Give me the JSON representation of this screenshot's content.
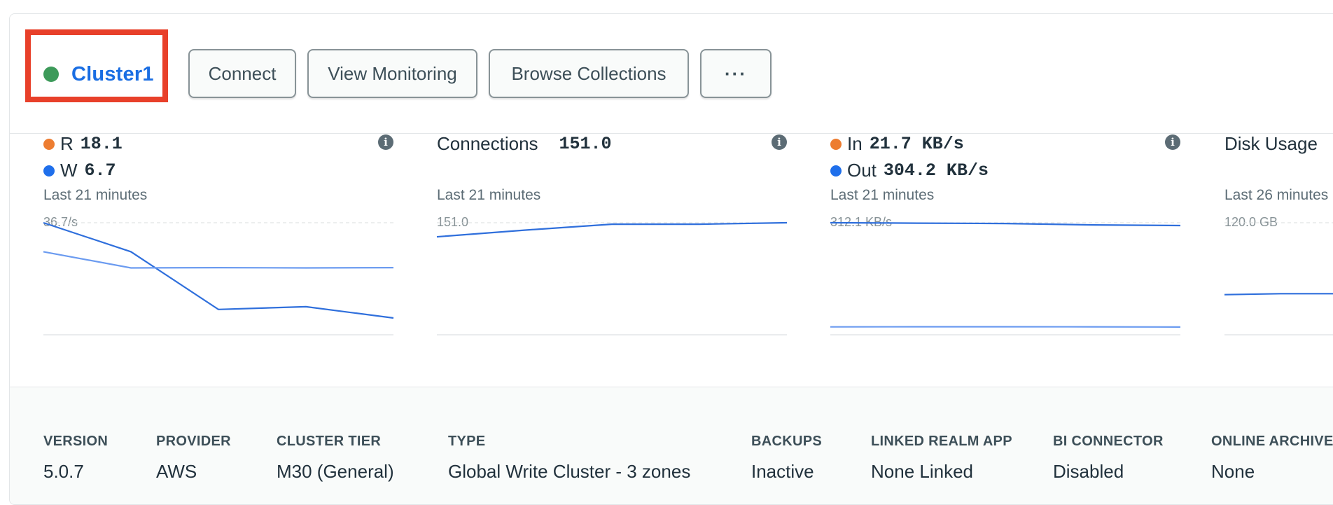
{
  "cluster": {
    "name": "Cluster1",
    "status_color": "#3d9a5a"
  },
  "toolbar": {
    "connect": "Connect",
    "view_monitoring": "View Monitoring",
    "browse_collections": "Browse Collections",
    "more": "···"
  },
  "colors": {
    "orange": "#ed7d31",
    "blue": "#1f6feb",
    "line": "#2f6fdc",
    "line_light": "#6b9bf0"
  },
  "metrics": {
    "opcounters": {
      "r_label": "R",
      "r_value": "18.1",
      "w_label": "W",
      "w_value": "6.7",
      "period": "Last 21 minutes",
      "max": "36.7/s",
      "info_icon": "i"
    },
    "connections": {
      "title": "Connections",
      "value": "151.0",
      "period": "Last 21 minutes",
      "max": "151.0",
      "info_icon": "i"
    },
    "network": {
      "in_label": "In",
      "in_value": "21.7 KB/s",
      "out_label": "Out",
      "out_value": "304.2 KB/s",
      "period": "Last 21 minutes",
      "max": "312.1 KB/s",
      "info_icon": "i"
    },
    "disk": {
      "title": "Disk Usage",
      "period": "Last 26 minutes",
      "max": "120.0 GB"
    }
  },
  "chart_data": [
    {
      "type": "line",
      "series": [
        {
          "values": [
            36.7,
            27.2,
            8.3,
            9.2,
            5.5
          ]
        },
        {
          "values": [
            27.2,
            21.9,
            22.0,
            21.9,
            22.0
          ]
        }
      ],
      "ylim": [
        0,
        36.7
      ]
    },
    {
      "type": "line",
      "series": [
        {
          "values": [
            132,
            141,
            149,
            149,
            151
          ]
        }
      ],
      "ylim": [
        0,
        151.0
      ]
    },
    {
      "type": "line",
      "series": [
        {
          "values": [
            312.1,
            311.0,
            310.0,
            306.0,
            304.2
          ]
        },
        {
          "values": [
            22.0,
            22.5,
            22.5,
            22.2,
            21.7
          ]
        }
      ],
      "ylim": [
        0,
        312.1
      ]
    },
    {
      "type": "line",
      "series": [
        {
          "values": [
            43,
            44,
            44
          ]
        }
      ],
      "ylim": [
        0,
        120.0
      ]
    }
  ],
  "details": [
    {
      "label": "VERSION",
      "value": "5.0.7"
    },
    {
      "label": "PROVIDER",
      "value": "AWS"
    },
    {
      "label": "CLUSTER TIER",
      "value": "M30 (General)"
    },
    {
      "label": "TYPE",
      "value": "Global Write Cluster - 3 zones"
    },
    {
      "label": "BACKUPS",
      "value": "Inactive"
    },
    {
      "label": "LINKED REALM APP",
      "value": "None Linked"
    },
    {
      "label": "BI CONNECTOR",
      "value": "Disabled"
    },
    {
      "label": "ONLINE ARCHIVE",
      "value": "None"
    }
  ]
}
